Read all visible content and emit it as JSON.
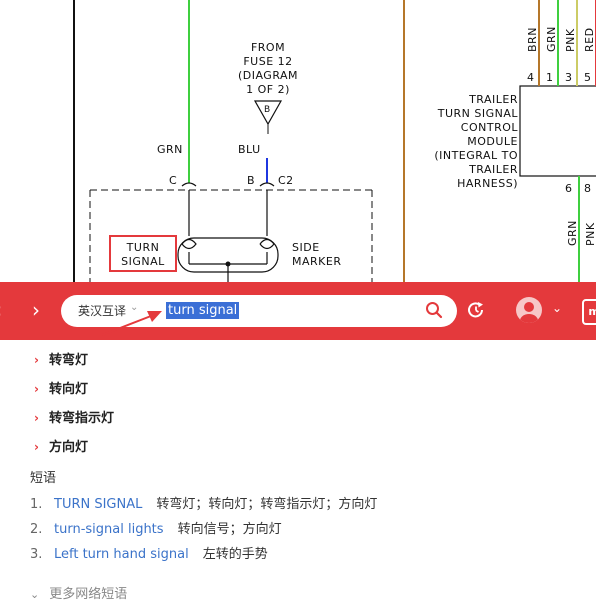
{
  "diagram": {
    "wire_labels": {
      "grn": "GRN",
      "blu": "BLU",
      "c": "C",
      "b": "B",
      "c2": "C2"
    },
    "fuse_lines": [
      "FROM",
      "FUSE 12",
      "(DIAGRAM",
      "1 OF 2)"
    ],
    "fuse_marker": "B",
    "turn_signal_lines": [
      "TURN",
      "SIGNAL"
    ],
    "side_marker_lines": [
      "SIDE",
      "MARKER"
    ],
    "module_lines": [
      "TRAILER",
      "TURN SIGNAL",
      "CONTROL",
      "MODULE",
      "(INTEGRAL TO",
      "TRAILER",
      "HARNESS)"
    ],
    "top_wires": [
      "BRN",
      "GRN",
      "PNK",
      "RED"
    ],
    "top_pins": [
      "4",
      "1",
      "3",
      "5"
    ],
    "bottom_pins": [
      "6",
      "8"
    ],
    "bottom_wires": [
      "GRN",
      "PNK"
    ],
    "colors": {
      "green": "#3fcf3f",
      "blue": "#1f37e0",
      "brown": "#b5772a",
      "red_box": "#e4393c"
    }
  },
  "toolbar": {
    "back_icon": "chevron-left-icon",
    "forward_icon": "chevron-right-icon",
    "lang_label": "英汉互译",
    "query": "turn signal",
    "mini_label": "mi",
    "accent": "#e4393c"
  },
  "results": {
    "translations": [
      "转弯灯",
      "转向灯",
      "转弯指示灯",
      "方向灯"
    ],
    "phrase_title": "短语",
    "phrases": [
      {
        "num": "1.",
        "en": "TURN SIGNAL",
        "zh": "转弯灯；转向灯；转弯指示灯；方向灯"
      },
      {
        "num": "2.",
        "en": "turn-signal lights",
        "zh": "转向信号；方向灯"
      },
      {
        "num": "3.",
        "en": "Left turn hand signal",
        "zh": "左转的手势"
      }
    ],
    "more_label": "更多网络短语"
  }
}
